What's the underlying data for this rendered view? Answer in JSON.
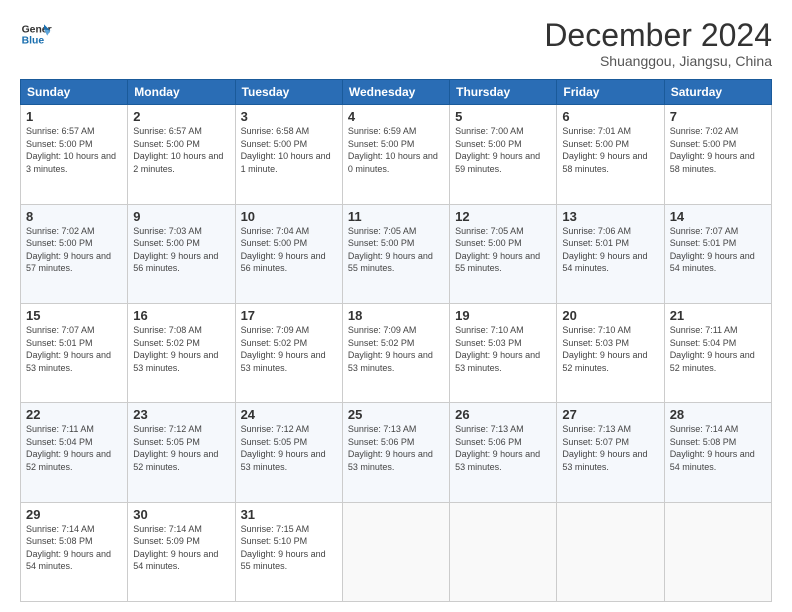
{
  "header": {
    "logo_line1": "General",
    "logo_line2": "Blue",
    "month": "December 2024",
    "location": "Shuanggou, Jiangsu, China"
  },
  "weekdays": [
    "Sunday",
    "Monday",
    "Tuesday",
    "Wednesday",
    "Thursday",
    "Friday",
    "Saturday"
  ],
  "weeks": [
    [
      {
        "day": "1",
        "sunrise": "6:57 AM",
        "sunset": "5:00 PM",
        "daylight": "10 hours and 3 minutes."
      },
      {
        "day": "2",
        "sunrise": "6:57 AM",
        "sunset": "5:00 PM",
        "daylight": "10 hours and 2 minutes."
      },
      {
        "day": "3",
        "sunrise": "6:58 AM",
        "sunset": "5:00 PM",
        "daylight": "10 hours and 1 minute."
      },
      {
        "day": "4",
        "sunrise": "6:59 AM",
        "sunset": "5:00 PM",
        "daylight": "10 hours and 0 minutes."
      },
      {
        "day": "5",
        "sunrise": "7:00 AM",
        "sunset": "5:00 PM",
        "daylight": "9 hours and 59 minutes."
      },
      {
        "day": "6",
        "sunrise": "7:01 AM",
        "sunset": "5:00 PM",
        "daylight": "9 hours and 58 minutes."
      },
      {
        "day": "7",
        "sunrise": "7:02 AM",
        "sunset": "5:00 PM",
        "daylight": "9 hours and 58 minutes."
      }
    ],
    [
      {
        "day": "8",
        "sunrise": "7:02 AM",
        "sunset": "5:00 PM",
        "daylight": "9 hours and 57 minutes."
      },
      {
        "day": "9",
        "sunrise": "7:03 AM",
        "sunset": "5:00 PM",
        "daylight": "9 hours and 56 minutes."
      },
      {
        "day": "10",
        "sunrise": "7:04 AM",
        "sunset": "5:00 PM",
        "daylight": "9 hours and 56 minutes."
      },
      {
        "day": "11",
        "sunrise": "7:05 AM",
        "sunset": "5:00 PM",
        "daylight": "9 hours and 55 minutes."
      },
      {
        "day": "12",
        "sunrise": "7:05 AM",
        "sunset": "5:00 PM",
        "daylight": "9 hours and 55 minutes."
      },
      {
        "day": "13",
        "sunrise": "7:06 AM",
        "sunset": "5:01 PM",
        "daylight": "9 hours and 54 minutes."
      },
      {
        "day": "14",
        "sunrise": "7:07 AM",
        "sunset": "5:01 PM",
        "daylight": "9 hours and 54 minutes."
      }
    ],
    [
      {
        "day": "15",
        "sunrise": "7:07 AM",
        "sunset": "5:01 PM",
        "daylight": "9 hours and 53 minutes."
      },
      {
        "day": "16",
        "sunrise": "7:08 AM",
        "sunset": "5:02 PM",
        "daylight": "9 hours and 53 minutes."
      },
      {
        "day": "17",
        "sunrise": "7:09 AM",
        "sunset": "5:02 PM",
        "daylight": "9 hours and 53 minutes."
      },
      {
        "day": "18",
        "sunrise": "7:09 AM",
        "sunset": "5:02 PM",
        "daylight": "9 hours and 53 minutes."
      },
      {
        "day": "19",
        "sunrise": "7:10 AM",
        "sunset": "5:03 PM",
        "daylight": "9 hours and 53 minutes."
      },
      {
        "day": "20",
        "sunrise": "7:10 AM",
        "sunset": "5:03 PM",
        "daylight": "9 hours and 52 minutes."
      },
      {
        "day": "21",
        "sunrise": "7:11 AM",
        "sunset": "5:04 PM",
        "daylight": "9 hours and 52 minutes."
      }
    ],
    [
      {
        "day": "22",
        "sunrise": "7:11 AM",
        "sunset": "5:04 PM",
        "daylight": "9 hours and 52 minutes."
      },
      {
        "day": "23",
        "sunrise": "7:12 AM",
        "sunset": "5:05 PM",
        "daylight": "9 hours and 52 minutes."
      },
      {
        "day": "24",
        "sunrise": "7:12 AM",
        "sunset": "5:05 PM",
        "daylight": "9 hours and 53 minutes."
      },
      {
        "day": "25",
        "sunrise": "7:13 AM",
        "sunset": "5:06 PM",
        "daylight": "9 hours and 53 minutes."
      },
      {
        "day": "26",
        "sunrise": "7:13 AM",
        "sunset": "5:06 PM",
        "daylight": "9 hours and 53 minutes."
      },
      {
        "day": "27",
        "sunrise": "7:13 AM",
        "sunset": "5:07 PM",
        "daylight": "9 hours and 53 minutes."
      },
      {
        "day": "28",
        "sunrise": "7:14 AM",
        "sunset": "5:08 PM",
        "daylight": "9 hours and 54 minutes."
      }
    ],
    [
      {
        "day": "29",
        "sunrise": "7:14 AM",
        "sunset": "5:08 PM",
        "daylight": "9 hours and 54 minutes."
      },
      {
        "day": "30",
        "sunrise": "7:14 AM",
        "sunset": "5:09 PM",
        "daylight": "9 hours and 54 minutes."
      },
      {
        "day": "31",
        "sunrise": "7:15 AM",
        "sunset": "5:10 PM",
        "daylight": "9 hours and 55 minutes."
      },
      null,
      null,
      null,
      null
    ]
  ]
}
